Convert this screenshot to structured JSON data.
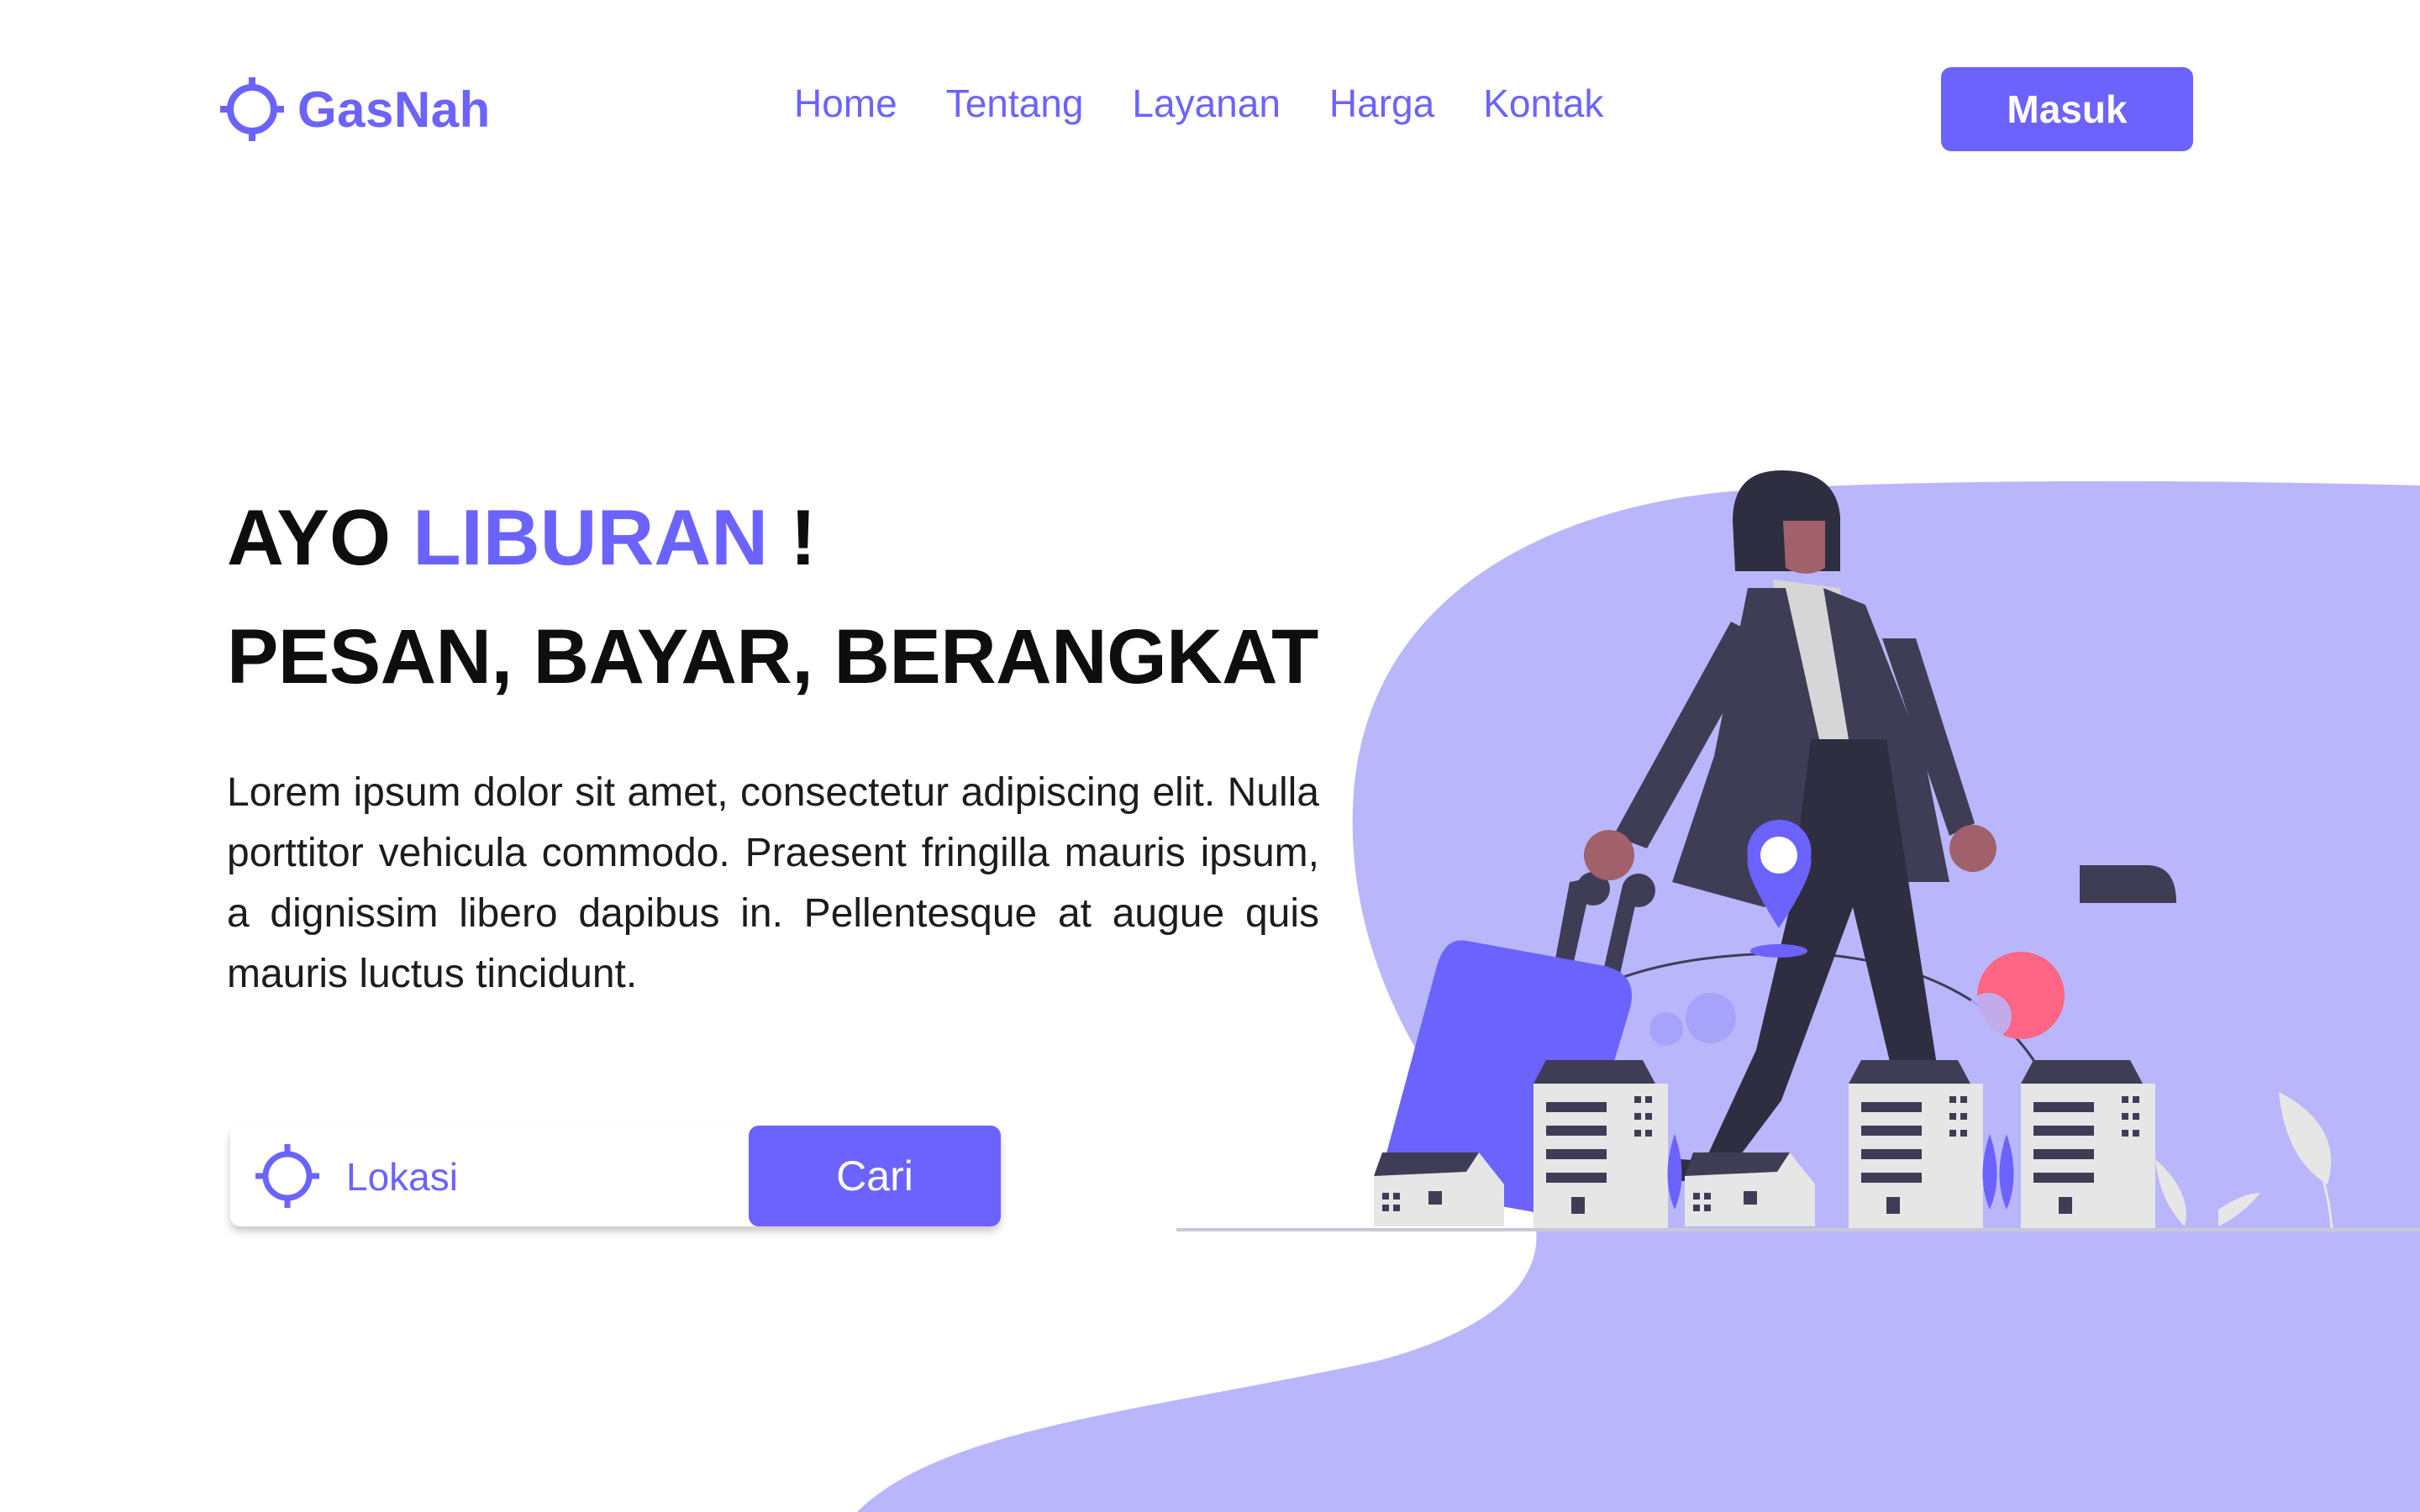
{
  "brand": {
    "name": "GasNah",
    "logo_icon": "crosshair-icon",
    "color": "#6c63ff"
  },
  "nav": {
    "links": [
      "Home",
      "Tentang",
      "Layanan",
      "Harga",
      "Kontak"
    ],
    "login_label": "Masuk"
  },
  "hero": {
    "headline_prefix": "AYO",
    "headline_accent": "LIBURAN",
    "headline_suffix": "!",
    "subheadline": "PESAN, BAYAR, BERANGKAT",
    "description": "Lorem ipsum dolor sit amet, consectetur adipiscing elit. Nulla porttitor vehicula commodo. Praesent fringilla mauris ipsum, a dignissim libero dapibus in. Pellentesque at augue quis mauris luctus tincidunt."
  },
  "search": {
    "icon": "crosshair-icon",
    "placeholder": "Lokasi",
    "value": "",
    "button_label": "Cari"
  },
  "colors": {
    "accent": "#6c63ff",
    "blob": "#b9b6fb",
    "text": "#0e0e0e",
    "pink": "#ff6584",
    "dark": "#3f3d56"
  }
}
